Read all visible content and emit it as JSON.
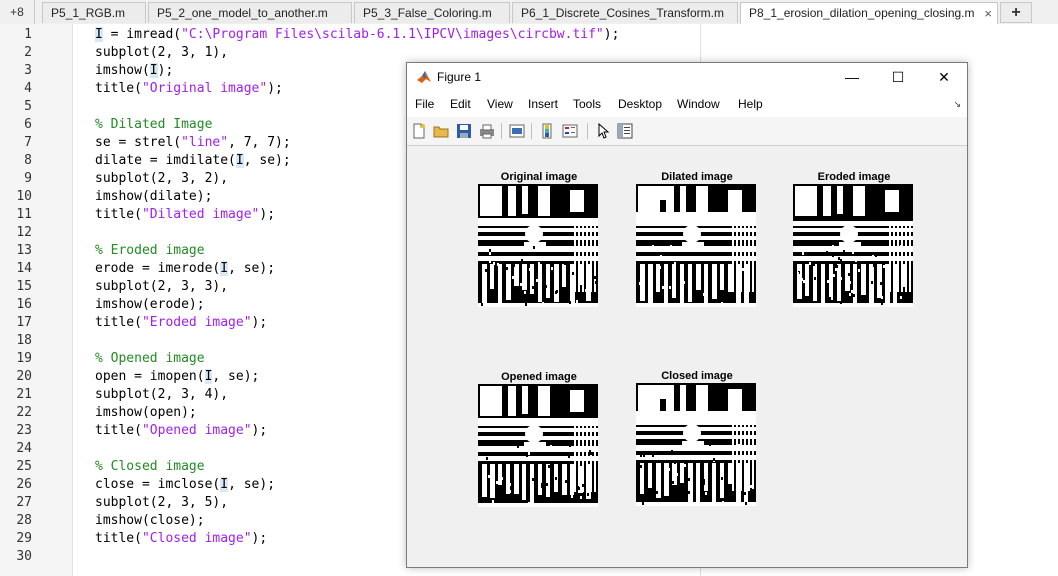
{
  "tabs": {
    "more": "+8",
    "items": [
      {
        "label": "P5_1_RGB.m"
      },
      {
        "label": "P5_2_one_model_to_another.m"
      },
      {
        "label": "P5_3_False_Coloring.m"
      },
      {
        "label": "P6_1_Discrete_Cosines_Transform.m"
      },
      {
        "label": "P8_1_erosion_dilation_opening_closing.m",
        "active": true
      }
    ],
    "close_glyph": "×",
    "add_glyph": "+"
  },
  "editor": {
    "lines": [
      {
        "n": "1",
        "code": "I = imread(\"C:\\Program Files\\scilab-6.1.1\\IPCV\\images\\circbw.tif\");"
      },
      {
        "n": "2",
        "code": "subplot(2, 3, 1),"
      },
      {
        "n": "3",
        "code": "imshow(I);"
      },
      {
        "n": "4",
        "code": "title(\"Original image\");"
      },
      {
        "n": "5",
        "code": ""
      },
      {
        "n": "6",
        "code": "% Dilated Image"
      },
      {
        "n": "7",
        "code": "se = strel(\"line\", 7, 7);"
      },
      {
        "n": "8",
        "code": "dilate = imdilate(I, se);"
      },
      {
        "n": "9",
        "code": "subplot(2, 3, 2),"
      },
      {
        "n": "10",
        "code": "imshow(dilate);"
      },
      {
        "n": "11",
        "code": "title(\"Dilated image\");"
      },
      {
        "n": "12",
        "code": ""
      },
      {
        "n": "13",
        "code": "% Eroded image"
      },
      {
        "n": "14",
        "code": "erode = imerode(I, se);"
      },
      {
        "n": "15",
        "code": "subplot(2, 3, 3),"
      },
      {
        "n": "16",
        "code": "imshow(erode);"
      },
      {
        "n": "17",
        "code": "title(\"Eroded image\");"
      },
      {
        "n": "18",
        "code": ""
      },
      {
        "n": "19",
        "code": "% Opened image"
      },
      {
        "n": "20",
        "code": "open = imopen(I, se);"
      },
      {
        "n": "21",
        "code": "subplot(2, 3, 4),"
      },
      {
        "n": "22",
        "code": "imshow(open);"
      },
      {
        "n": "23",
        "code": "title(\"Opened image\");"
      },
      {
        "n": "24",
        "code": ""
      },
      {
        "n": "25",
        "code": "% Closed image"
      },
      {
        "n": "26",
        "code": "close = imclose(I, se);"
      },
      {
        "n": "27",
        "code": "subplot(2, 3, 5),"
      },
      {
        "n": "28",
        "code": "imshow(close);"
      },
      {
        "n": "29",
        "code": "title(\"Closed image\");"
      },
      {
        "n": "30",
        "code": ""
      }
    ],
    "colors": {
      "string": "#a020f0",
      "comment": "#228b22",
      "highlight": "#d8e8f4"
    }
  },
  "figure": {
    "title": "Figure 1",
    "icon": "matlab-logo-icon",
    "window_buttons": {
      "minimize": "—",
      "maximize": "☐",
      "close": "✕"
    },
    "menu": [
      "File",
      "Edit",
      "View",
      "Insert",
      "Tools",
      "Desktop",
      "Window",
      "Help"
    ],
    "menu_overflow": "↘",
    "toolbar_icons": [
      "new-figure-icon",
      "open-file-icon",
      "save-icon",
      "print-icon",
      "print-preview-icon",
      "insert-colorbar-icon",
      "insert-legend-icon",
      "edit-plot-icon",
      "property-inspector-icon"
    ],
    "subplots": [
      {
        "title": "Original image",
        "variant": 0
      },
      {
        "title": "Dilated image",
        "variant": 1
      },
      {
        "title": "Eroded image",
        "variant": 2
      },
      {
        "title": "Opened image",
        "variant": 3
      },
      {
        "title": "Closed image",
        "variant": 4
      }
    ]
  }
}
